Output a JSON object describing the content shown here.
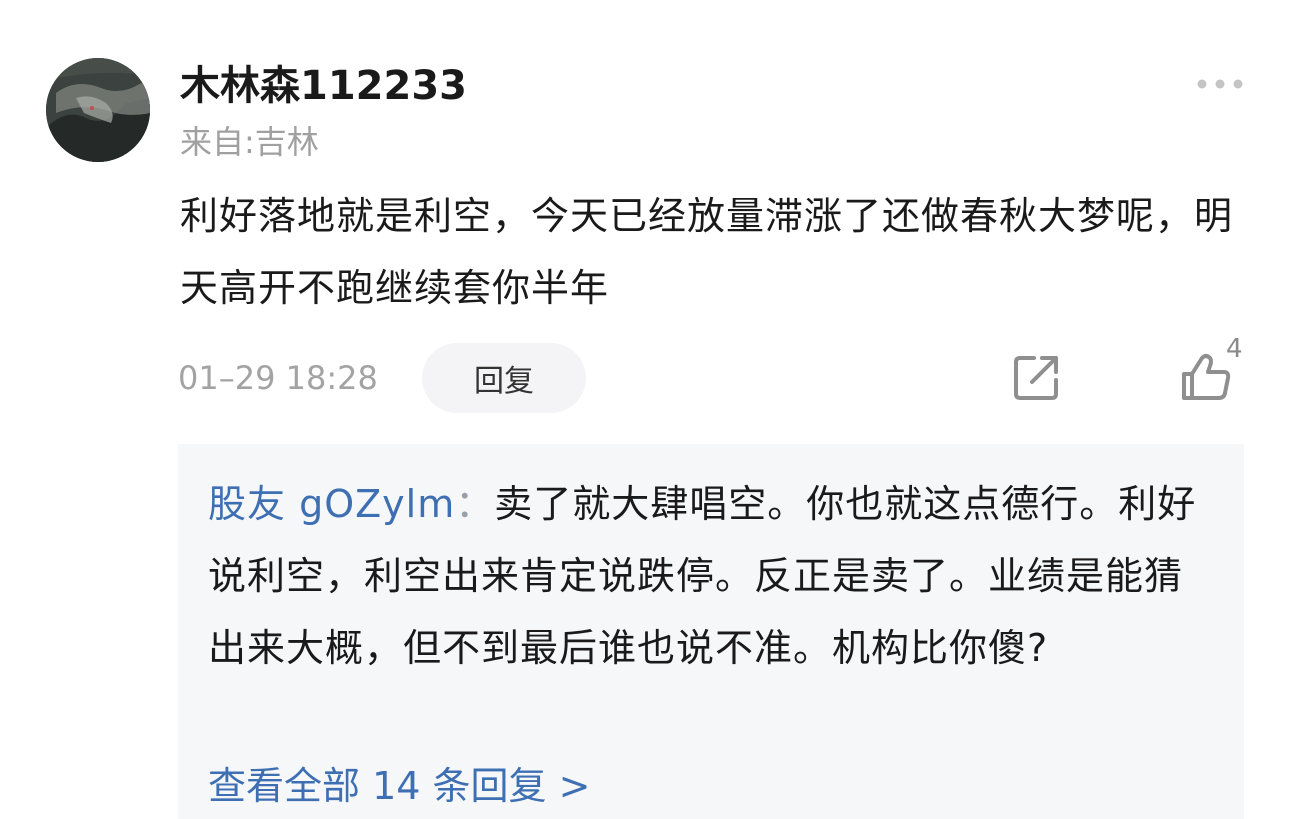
{
  "comment": {
    "username": "木林森112233",
    "location": "来自:吉林",
    "body": "利好落地就是利空，今天已经放量滞涨了还做春秋大梦呢，明天高开不跑继续套你半年",
    "timestamp": "01–29 18:28",
    "reply_label": "回复",
    "like_count": "4",
    "icons": {
      "more": "more-dots-icon",
      "share": "share-icon",
      "like": "thumbs-up-icon"
    }
  },
  "replies": {
    "items": [
      {
        "author": "股友 gOZylm",
        "separator": "：",
        "text": "卖了就大肆唱空。你也就这点德行。利好说利空，利空出来肯定说跌停。反正是卖了。业绩是能猜出来大概，但不到最后谁也说不准。机构比你傻?"
      }
    ],
    "view_all": "查看全部 14 条回复 >"
  },
  "colors": {
    "link_blue": "#3e6fb3",
    "muted_gray": "#a3a3a3",
    "reply_bg": "#f6f7f9",
    "pill_bg": "#f4f4f6"
  }
}
